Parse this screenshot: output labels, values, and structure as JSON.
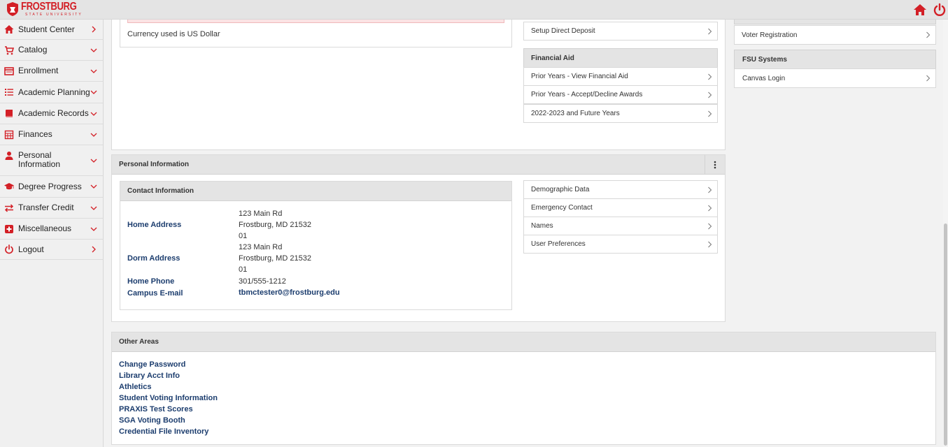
{
  "brand": {
    "name": "FROSTBURG",
    "sub": "STATE UNIVERSITY",
    "color": "#d31f26"
  },
  "header": {
    "home_icon": "home-icon",
    "power_icon": "power-icon"
  },
  "sidebar": {
    "items": [
      {
        "label": "Student Center",
        "icon": "home-icon",
        "arrow": "right"
      },
      {
        "label": "Catalog",
        "icon": "cart-icon",
        "arrow": "down"
      },
      {
        "label": "Enrollment",
        "icon": "window-icon",
        "arrow": "down"
      },
      {
        "label": "Academic Planning",
        "icon": "list-icon",
        "arrow": "down"
      },
      {
        "label": "Academic Records",
        "icon": "book-icon",
        "arrow": "down"
      },
      {
        "label": "Finances",
        "icon": "calculator-icon",
        "arrow": "down"
      },
      {
        "label": "Personal Information",
        "line1": "Personal",
        "line2": "Information",
        "icon": "user-icon",
        "arrow": "down"
      },
      {
        "label": "Degree Progress",
        "icon": "graduation-cap-icon",
        "arrow": "down"
      },
      {
        "label": "Transfer Credit",
        "icon": "exchange-icon",
        "arrow": "down"
      },
      {
        "label": "Miscellaneous",
        "icon": "plus-square-icon",
        "arrow": "down"
      },
      {
        "label": "Logout",
        "icon": "power-icon",
        "arrow": "right"
      }
    ]
  },
  "finance": {
    "currency_note": "Currency used is US Dollar",
    "direct_deposit": "Setup Direct Deposit",
    "financial_aid": {
      "title": "Financial Aid",
      "links": [
        "Prior Years - View Financial Aid",
        "Prior Years - Accept/Decline Awards",
        "2022-2023 and Future Years"
      ]
    }
  },
  "right_column": {
    "voter_registration": "Voter Registration",
    "fsu_systems": {
      "title": "FSU Systems",
      "links": [
        "Canvas Login"
      ]
    }
  },
  "personal_info": {
    "title": "Personal Information",
    "contact": {
      "title": "Contact Information",
      "home_address_label": "Home Address",
      "home_address": [
        "123 Main Rd",
        "Frostburg, MD 21532",
        "01"
      ],
      "dorm_address_label": "Dorm Address",
      "dorm_address": [
        "123 Main Rd",
        "Frostburg, MD 21532",
        "01"
      ],
      "home_phone_label": "Home Phone",
      "home_phone": "301/555-1212",
      "email_label": "Campus E-mail",
      "email": "tbmctester0@frostburg.edu"
    },
    "links": [
      "Demographic Data",
      "Emergency Contact",
      "Names",
      "User Preferences"
    ]
  },
  "other_areas": {
    "title": "Other Areas",
    "links": [
      "Change Password",
      "Library Acct Info",
      "Athletics",
      "Student Voting Information",
      "PRAXIS Test Scores",
      "SGA Voting Booth",
      "Credential File Inventory"
    ]
  }
}
